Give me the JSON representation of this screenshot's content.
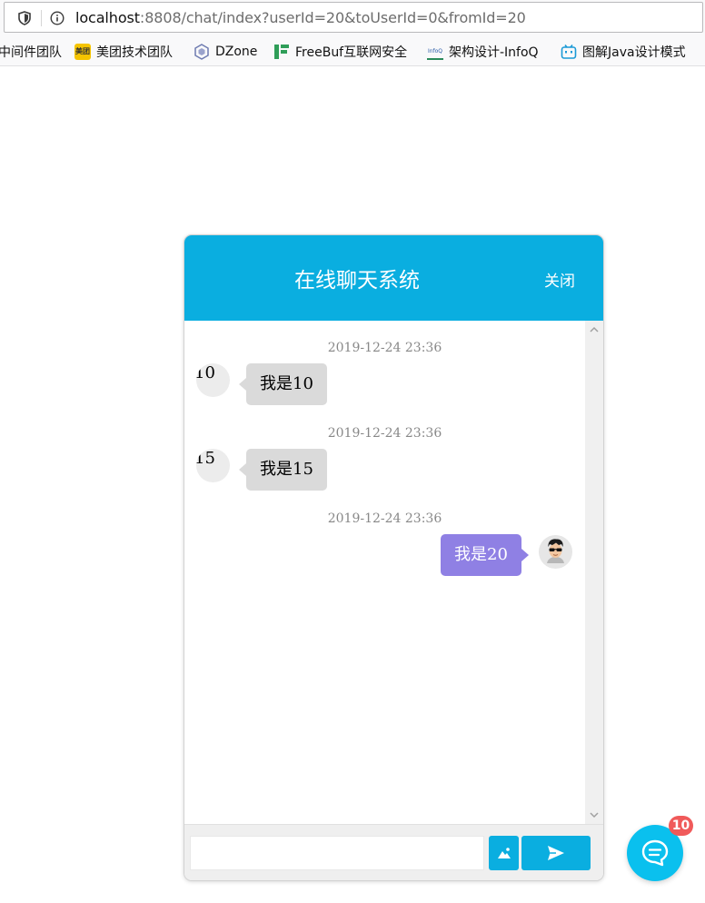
{
  "browser": {
    "url_host": "localhost",
    "url_rest": ":8808/chat/index?userId=20&toUserId=0&fromId=20",
    "bookmarks": [
      {
        "label": "中间件团队",
        "icon": "none"
      },
      {
        "label": "美团技术团队",
        "icon": "meituan-icon",
        "icon_text": "美团"
      },
      {
        "label": "DZone",
        "icon": "dzone-icon"
      },
      {
        "label": "FreeBuf互联网安全",
        "icon": "freebuf-icon"
      },
      {
        "label": "架构设计-InfoQ",
        "icon": "infoq-icon",
        "icon_text": "InfoQ"
      },
      {
        "label": "图解Java设计模式",
        "icon": "bilibili-icon"
      }
    ]
  },
  "chat": {
    "title": "在线聊天系统",
    "close_label": "关闭",
    "messages": [
      {
        "time": "2019-12-24 23:36",
        "side": "left",
        "avatar_label": "10",
        "text": "我是10"
      },
      {
        "time": "2019-12-24 23:36",
        "side": "left",
        "avatar_label": "15",
        "text": "我是15"
      },
      {
        "time": "2019-12-24 23:36",
        "side": "right",
        "avatar": "user-avatar-sunglasses",
        "text": "我是20"
      }
    ],
    "input_value": "",
    "image_button_icon": "image-icon",
    "send_button_icon": "send-icon"
  },
  "widget": {
    "badge_count": "10",
    "icon": "chat-bubble-icon"
  },
  "colors": {
    "header": "#0aaee0",
    "right_bubble": "#8f80e4",
    "left_bubble": "#dadada",
    "badge": "#f05a5a"
  }
}
